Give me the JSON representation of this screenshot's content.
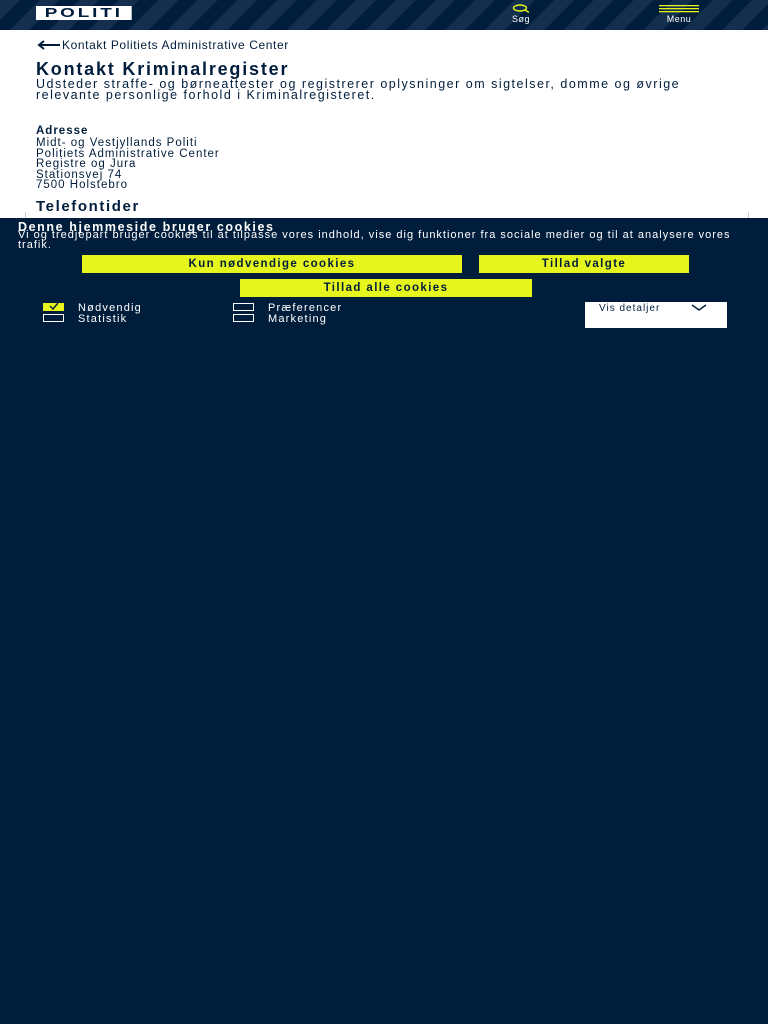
{
  "header": {
    "logo": "POLITI",
    "search_label": "Søg",
    "menu_label": "Menu"
  },
  "content": {
    "back_link": "Kontakt Politiets Administrative Center",
    "title": "Kontakt Kriminalregister",
    "intro": "Udsteder straffe- og børneattester og registrerer oplysninger om sigtelser, domme og øvrige relevante personlige forhold i Kriminalregisteret.",
    "address_heading": "Adresse",
    "address_lines": [
      "Midt- og Vestjyllands Politi",
      "Politiets Administrative Center",
      "Registre og Jura",
      "Stationsvej 74",
      "7500 Holstebro"
    ],
    "phone_heading": "Telefontider"
  },
  "cookie_banner": {
    "title": "Denne hjemmeside bruger cookies",
    "text": "Vi og tredjepart bruger cookies til at tilpasse vores indhold, vise dig funktioner fra sociale medier og til at analysere vores trafik.",
    "btn_necessary": "Kun nødvendige cookies",
    "btn_selected": "Tillad valgte",
    "btn_all": "Tillad alle cookies",
    "checkboxes": [
      {
        "label": "Nødvendig",
        "checked": true
      },
      {
        "label": "Præferencer",
        "checked": false
      },
      {
        "label": "Statistik",
        "checked": false
      },
      {
        "label": "Marketing",
        "checked": false
      }
    ],
    "details_label": "Vis detaljer"
  },
  "colors": {
    "navy": "#001e3c",
    "accent": "#e6f51c",
    "white": "#ffffff"
  }
}
